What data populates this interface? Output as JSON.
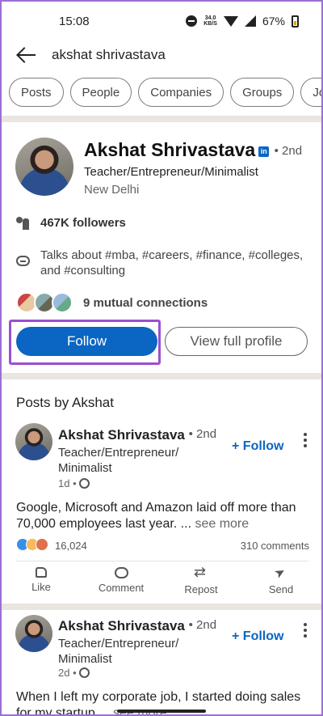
{
  "status_bar": {
    "time": "15:08",
    "net_speed_top": "34.0",
    "net_speed_unit": "KB/S",
    "battery": "67%"
  },
  "search": {
    "query": "akshat shrivastava"
  },
  "filters": [
    "Posts",
    "People",
    "Companies",
    "Groups",
    "Jo"
  ],
  "profile": {
    "name": "Akshat Shrivastava",
    "linkedin_badge": "in",
    "degree": "• 2nd",
    "headline": "Teacher/Entrepreneur/Minimalist",
    "location": "New Delhi",
    "followers": "467K followers",
    "talks_about": "Talks about #mba, #careers, #finance, #colleges, and #consulting",
    "mutual": "9 mutual connections",
    "follow_label": "Follow",
    "view_profile_label": "View full profile"
  },
  "posts_section": {
    "title": "Posts by Akshat",
    "posts": [
      {
        "author": "Akshat Shrivastava",
        "degree": "• 2nd",
        "headline": "Teacher/Entrepreneur/ Minimalist",
        "age": "1d •",
        "follow_label": "+ Follow",
        "text": "Google, Microsoft and Amazon laid off more than 70,000 employees last year. ...",
        "see_more": " see more",
        "reactions": "16,024",
        "comments": "310 comments"
      },
      {
        "author": "Akshat Shrivastava",
        "degree": "• 2nd",
        "headline": "Teacher/Entrepreneur/ Minimalist",
        "age": "2d •",
        "follow_label": "+ Follow",
        "text": "When I left my corporate job, I started doing sales for my startup ...",
        "see_more": " see more"
      }
    ],
    "actions": [
      "Like",
      "Comment",
      "Repost",
      "Send"
    ]
  },
  "colors": {
    "accent": "#0a66c2",
    "highlight": "#9b4fd1",
    "band": "#e9e5df"
  }
}
